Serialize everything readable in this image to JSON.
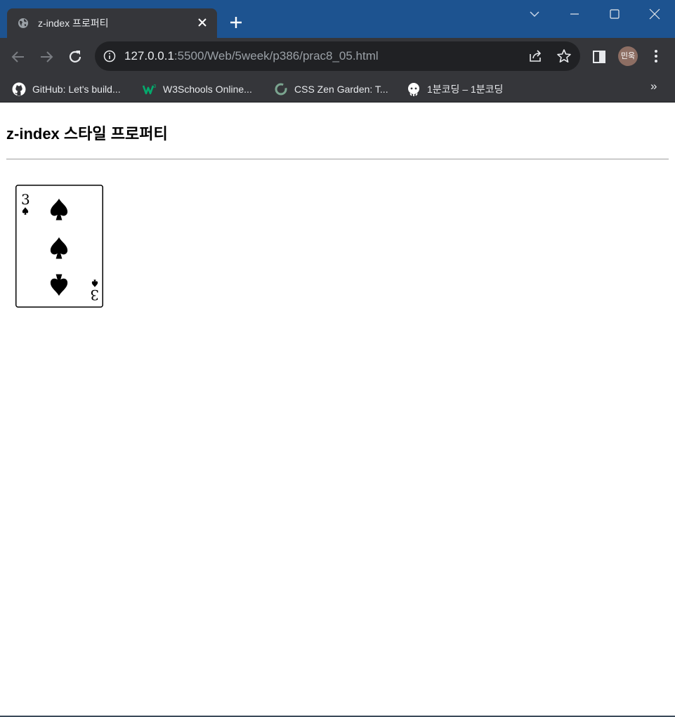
{
  "browser": {
    "tab_title": "z-index 프로퍼티",
    "url_host": "127.0.0.1",
    "url_rest": ":5500/Web/5week/p386/prac8_05.html",
    "profile_label": "민욱",
    "bookmarks": [
      {
        "label": "GitHub: Let's build...",
        "icon": "github-icon"
      },
      {
        "label": "W3Schools Online...",
        "icon": "w3schools-icon"
      },
      {
        "label": "CSS Zen Garden: T...",
        "icon": "zen-garden-icon"
      },
      {
        "label": "1분코딩 – 1분코딩",
        "icon": "1min-coding-icon"
      }
    ],
    "bookmarks_more": "»"
  },
  "page": {
    "heading": "z-index 스타일 프로퍼티",
    "card": {
      "rank": "3",
      "suit": "spade",
      "pips": 3
    }
  }
}
